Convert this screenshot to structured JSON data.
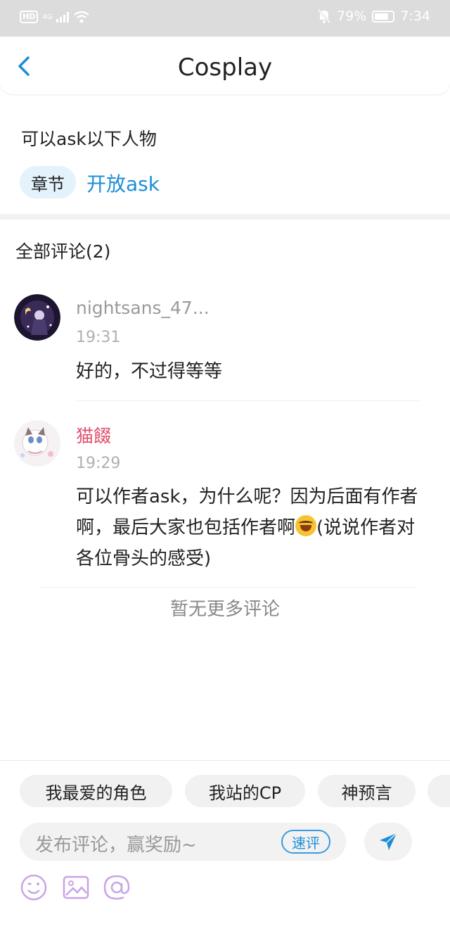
{
  "status_bar": {
    "hd": "HD",
    "network": "4G",
    "battery_percent": "79%",
    "battery_level": 0.79,
    "time": "7:34",
    "icons": [
      "signal-icon",
      "wifi-icon",
      "bell-off-icon",
      "battery-icon"
    ]
  },
  "header": {
    "title": "Cosplay",
    "back_icon": "chevron-left-icon"
  },
  "intro": {
    "text": "可以ask以下人物",
    "chapter_chip": "章节",
    "open_ask": "开放ask"
  },
  "comments": {
    "title": "全部评论(2)",
    "items": [
      {
        "user": "nightsans_47...",
        "time": "19:31",
        "text": "好的，不过得等等"
      },
      {
        "user": "猫餟",
        "time": "19:29",
        "text": "可以作者ask，为什么呢？因为后面有作者啊，最后大家也包括作者啊",
        "text_after_emoji": "(说说作者对各位骨头的感受)"
      }
    ],
    "no_more": "暂无更多评论"
  },
  "composer": {
    "quick_chips": [
      "我最爱的角色",
      "我站的CP",
      "神预言"
    ],
    "placeholder": "发布评论，赢奖励~",
    "quick_review": "速评",
    "send_icon": "send-icon",
    "tool_icons": [
      "emoji-icon",
      "image-icon",
      "at-icon"
    ]
  },
  "colors": {
    "accent_blue": "#1b8ed8",
    "username_pink": "#e0506e",
    "username_gray": "#9a9a9a",
    "tool_purple": "#c8a4e8"
  }
}
